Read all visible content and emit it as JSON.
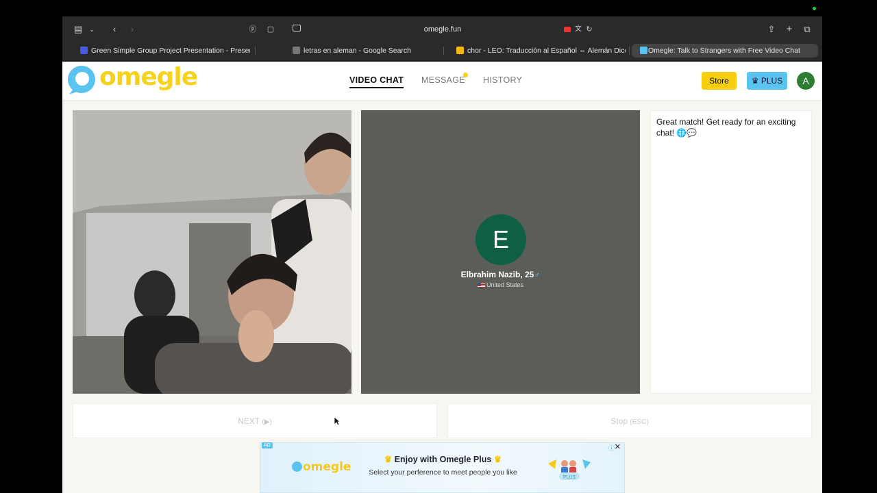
{
  "browser": {
    "url": "omegle.fun",
    "tabs": [
      {
        "title": "Green Simple Group Project Presentation - Presen...",
        "favicon_color": "#4a5ae8"
      },
      {
        "title": "letras en aleman - Google Search",
        "favicon_color": "#777777"
      },
      {
        "title": "chor - LEO: Traducción al Español ⇔ Alemán Dicci...",
        "favicon_color": "#f5b800"
      },
      {
        "title": "Omegle: Talk to Strangers with Free Video Chat",
        "favicon_color": "#5bc3ef"
      }
    ]
  },
  "site": {
    "logo_text": "omegle",
    "nav": [
      {
        "label": "VIDEO CHAT",
        "active": true
      },
      {
        "label": "MESSAGE",
        "active": false
      },
      {
        "label": "HISTORY",
        "active": false
      }
    ],
    "store_label": "Store",
    "plus_label": "PLUS",
    "account_initial": "A",
    "colors": {
      "brand_yellow": "#f7d21c",
      "plus_blue": "#5bc3ef",
      "avatar_green": "#0e5f43"
    }
  },
  "peer": {
    "initial": "E",
    "name": "Elbrahim Nazib, 25",
    "gender_symbol": "♂",
    "country": "United States"
  },
  "chat": {
    "message": "Great match! Get ready for an exciting chat! 🌐💬"
  },
  "controls": {
    "next_label": "NEXT",
    "next_hint": "(▶)",
    "stop_label": "Stop",
    "stop_hint": "(ESC)"
  },
  "ad": {
    "tag": "AD",
    "logo_text": "omegle",
    "title": "Enjoy with Omegle Plus",
    "subtitle": "Select your perference to meet people you like",
    "badge": "PLUS"
  }
}
